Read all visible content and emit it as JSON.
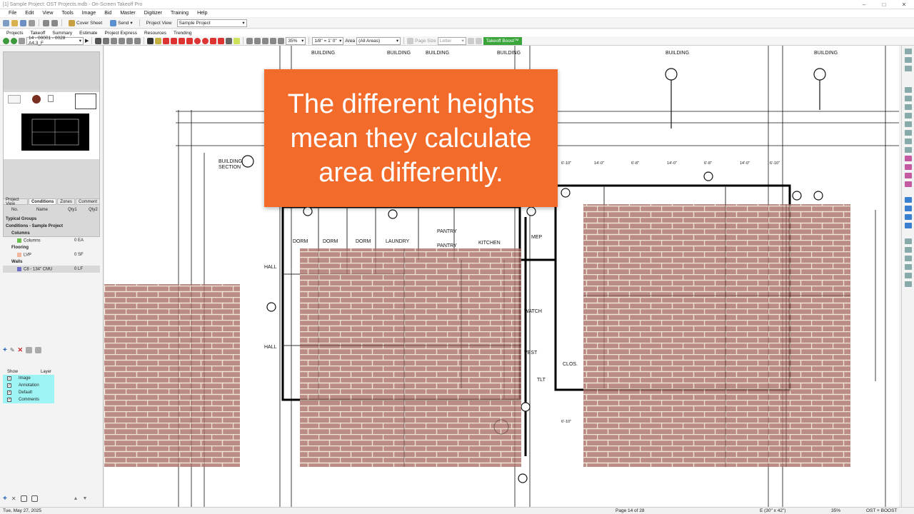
{
  "window": {
    "title": "[1] Sample Project: OST Projects.mdb - On-Screen Takeoff Pro"
  },
  "menu": [
    "File",
    "Edit",
    "View",
    "Tools",
    "Image",
    "Bid",
    "Master",
    "Digitizer",
    "Training",
    "Help"
  ],
  "toolbar1": {
    "cover_sheet": "Cover Sheet",
    "send": "Send",
    "project_view": "Project View",
    "project_select": "Sample Project"
  },
  "nav": [
    "Projects",
    "Takeoff",
    "Summary",
    "Estimate",
    "Project Express",
    "Resources",
    "Trending"
  ],
  "toolbar2": {
    "page_select": "14 - 00001 - 0028 A4.3_F",
    "zoom": "35%",
    "scale": "1/8\" = 1' 0\"",
    "area_label": "Area",
    "area_value": "(All Areas)",
    "page_size_label": "Page Size",
    "page_size_value": "Letter",
    "boost_label": "Takeoff Boost™"
  },
  "left_tabs": [
    "Project View",
    "Conditions",
    "Zones",
    "Comment"
  ],
  "conditions": {
    "header": {
      "no": "No.",
      "name": "Name",
      "qty1": "Qty1",
      "qty2": "Qty2"
    },
    "rows": [
      {
        "name": "Typical Groups",
        "qty": "",
        "indent": 0,
        "bold": true
      },
      {
        "name": "Conditions - Sample Project",
        "qty": "",
        "indent": 0,
        "bold": true
      },
      {
        "name": "Columns",
        "qty": "",
        "indent": 1,
        "bold": true
      },
      {
        "name": "Columns",
        "qty": "0 EA",
        "indent": 2,
        "bold": false,
        "swatch": "#6bbf4e"
      },
      {
        "name": "Flooring",
        "qty": "",
        "indent": 1,
        "bold": true
      },
      {
        "name": "LVP",
        "qty": "0 SF",
        "indent": 2,
        "bold": false,
        "swatch": "#f2b49a"
      },
      {
        "name": "Walls",
        "qty": "",
        "indent": 1,
        "bold": true
      },
      {
        "name": "C8 - 134\" CMU",
        "qty": "0 LF",
        "indent": 2,
        "bold": false,
        "swatch": "#6e6ec8",
        "selected": true
      }
    ]
  },
  "layers": {
    "header": {
      "show": "Show",
      "layer": "Layer"
    },
    "rows": [
      "Image",
      "Annotation",
      "Default",
      "Comments"
    ]
  },
  "callout": {
    "text": "The different heights mean they calculate area differently."
  },
  "status": {
    "date": "Tue, May 27, 2025",
    "page": "Page 14 of 28",
    "sheet_size": "E (30\" x 42\")",
    "zoom": "35%",
    "mode": "OST + BOOST"
  },
  "colors": {
    "callout": "#f26b2a",
    "boost": "#39a53a",
    "brick": "#a86a64",
    "layer_highlight": "#9ef4f4"
  }
}
